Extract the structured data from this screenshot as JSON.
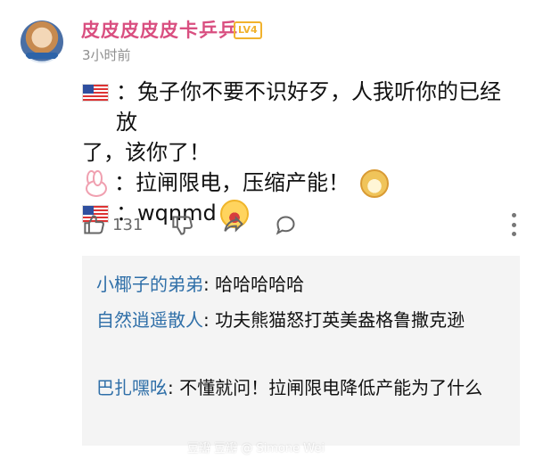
{
  "user": {
    "name": "皮皮皮皮皮卡乒乒",
    "level": "LV4",
    "time": "3小时前"
  },
  "comment": {
    "lines": [
      {
        "prefix_icon": "us-flag-icon",
        "text": "：兔子你不要不识好歹，人我听你的已经放"
      },
      {
        "prefix_icon": "",
        "text": "了，该你了！"
      },
      {
        "prefix_icon": "rabbit-icon",
        "text": "：拉闸限电，压缩产能！"
      },
      {
        "prefix_icon": "us-flag-icon",
        "text": "：wqnmd"
      }
    ],
    "emoji_1": "smug-doge-icon",
    "emoji_2": "angry-face-icon"
  },
  "actions": {
    "likes": "131"
  },
  "replies": [
    {
      "name": "小椰子的弟弟",
      "text": ": 哈哈哈哈哈"
    },
    {
      "name": "自然逍遥散人",
      "text": ": 功夫熊猫怒打英美盎格鲁撒克逊"
    },
    {
      "name": "巴扎嘿吆",
      "text": ": 不懂就问！拉闸限电降低产能为了什么"
    }
  ],
  "watermark": "豆瓣  豆瓣 @ Simone Wei"
}
